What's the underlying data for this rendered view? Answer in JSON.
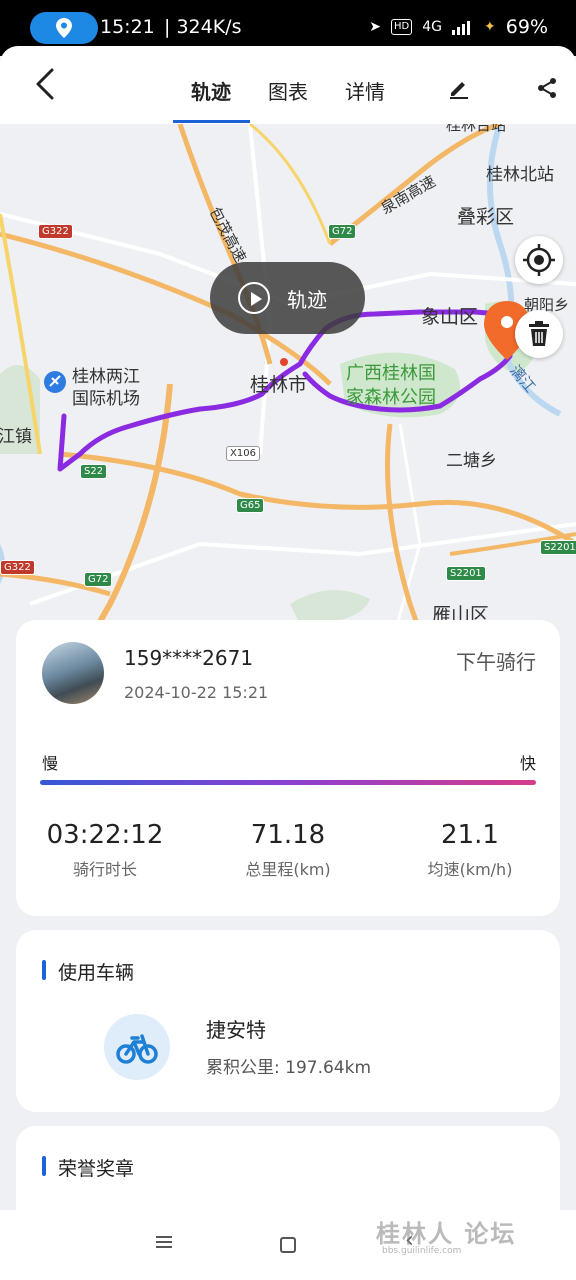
{
  "status_bar": {
    "time": "15:21",
    "network_speed": "| 324K/s",
    "network_type": "4G",
    "battery": "69%",
    "hd_label": "HD"
  },
  "header": {
    "tabs": [
      {
        "label": "轨迹"
      },
      {
        "label": "图表"
      },
      {
        "label": "详情"
      }
    ],
    "active_tab": "轨迹"
  },
  "map": {
    "play_label": "轨迹",
    "labels": {
      "guilin_north": "桂林北站",
      "diecai": "叠彩区",
      "xiangshan": "象山区",
      "guilin_city": "桂林市",
      "forest_park_1": "广西桂林国",
      "forest_park_2": "家森林公园",
      "airport_1": "桂林两江",
      "airport_2": "国际机场",
      "erpoxiang": "二塘乡",
      "yanshan": "雁山区",
      "jiang_town": "江镇",
      "quannan": "泉南高速",
      "baomao": "包茂高速",
      "lijiang": "漓江",
      "chaoyang": "朝阳乡",
      "guilin_top": "桂林台站"
    },
    "road_badges": {
      "g322_a": "G322",
      "g72_a": "G72",
      "s22": "S22",
      "x106": "X106",
      "g65": "G65",
      "g322_b": "G322",
      "g72_b": "G72",
      "s2201_a": "S2201",
      "s2201_b": "S2201"
    },
    "route_color": "#8a2be2",
    "end_marker_color": "#f26b2a"
  },
  "ride": {
    "user_name": "159****2671",
    "datetime": "2024-10-22 15:21",
    "ride_type": "下午骑行",
    "slow_label": "慢",
    "fast_label": "快",
    "stats": [
      {
        "value": "03:22:12",
        "label": "骑行时长"
      },
      {
        "value": "71.18",
        "label": "总里程(km)"
      },
      {
        "value": "21.1",
        "label": "均速(km/h)"
      }
    ]
  },
  "vehicle": {
    "section_title": "使用车辆",
    "name": "捷安特",
    "mileage": "累积公里: 197.64km"
  },
  "medal": {
    "section_title": "荣誉奖章"
  },
  "watermark": {
    "text": "桂林人 论坛",
    "sub": "bbs.guilinlife.com"
  }
}
